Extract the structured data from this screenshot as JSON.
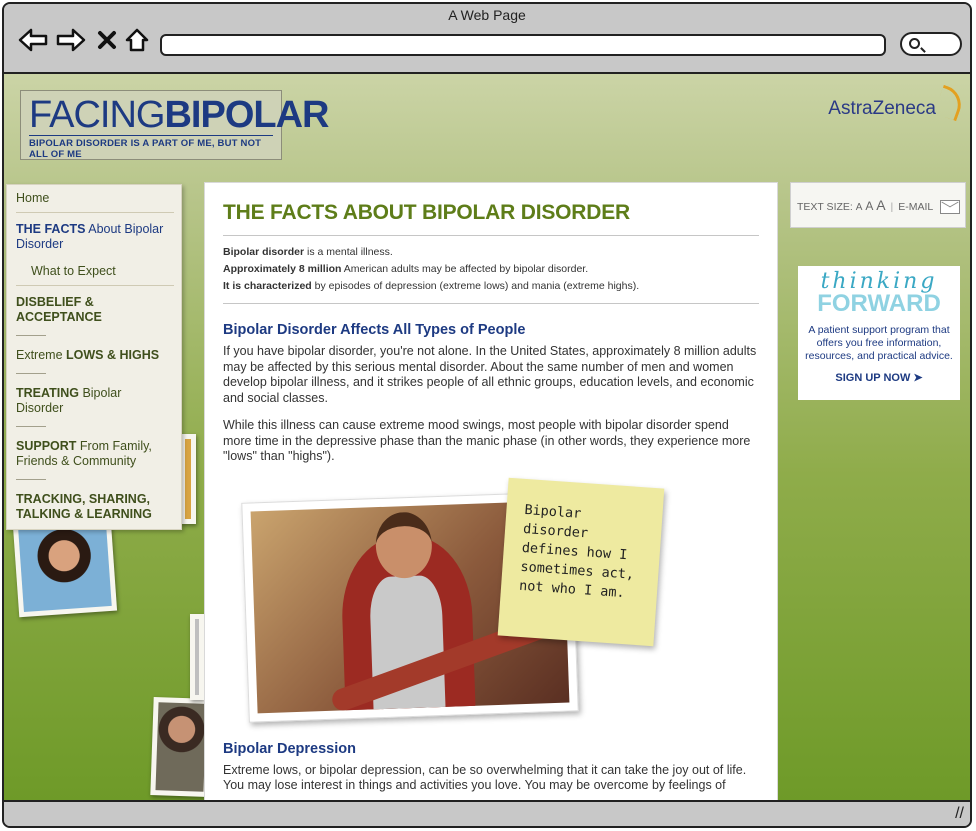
{
  "window": {
    "title": "A Web Page"
  },
  "browser": {
    "back_icon": "back-arrow-icon",
    "forward_icon": "forward-arrow-icon",
    "stop_icon": "close-icon",
    "home_icon": "home-icon",
    "search_icon": "search-icon"
  },
  "header": {
    "logo_thin": "FACING",
    "logo_bold": "BIPOLAR",
    "tagline": "BIPOLAR DISORDER IS A PART OF ME, BUT NOT ALL OF ME",
    "sponsor": "AstraZeneca"
  },
  "nav": {
    "home": "Home",
    "facts_bold": "THE FACTS",
    "facts_rest": " About Bipolar Disorder",
    "expect": "What to Expect",
    "disbelief": "DISBELIEF & ACCEPTANCE",
    "lows_pre": "Extreme ",
    "lows_bold": "LOWS & HIGHS",
    "treating_bold": "TREATING",
    "treating_rest": " Bipolar Disorder",
    "support_bold": "SUPPORT",
    "support_rest": " From Family, Friends & Community",
    "tracking": "TRACKING, SHARING, TALKING & LEARNING"
  },
  "content": {
    "title": "THE FACTS ABOUT BIPOLAR DISORDER",
    "facts": [
      {
        "bold": "Bipolar disorder",
        "rest": " is a mental illness."
      },
      {
        "bold": "Approximately 8 million",
        "rest": " American adults may be affected by bipolar disorder."
      },
      {
        "bold": "It is characterized",
        "rest": " by episodes of depression (extreme lows) and mania (extreme highs)."
      }
    ],
    "h2_types": "Bipolar Disorder Affects All Types of People",
    "p1": "If you have bipolar disorder, you're not alone. In the United States, approximately 8 million adults may be affected by this serious mental disorder. About the same number of men and women develop bipolar illness, and it strikes people of all ethnic groups, education levels, and economic and social classes.",
    "p2": "While this illness can cause extreme mood swings, most people with bipolar disorder spend more time in the depressive phase than the manic phase (in other words, they experience more \"lows\" than \"highs\").",
    "note": "Bipolar disorder defines how I sometimes act, not who I am.",
    "h2_depression": "Bipolar Depression",
    "p3": "Extreme lows, or bipolar depression, can be so overwhelming that it can take the joy out of life. You may lose interest in things and activities you love. You may be overcome by feelings of"
  },
  "tools": {
    "text_size_label": "TEXT SIZE:",
    "a_small": "A",
    "a_medium": "A",
    "a_large": "A",
    "email_label": "E-MAIL",
    "email_icon": "envelope-icon"
  },
  "promo": {
    "line1": "thinking",
    "line2": "FORWARD",
    "description": "A patient support program that offers you free information, resources, and practical advice.",
    "cta": "SIGN UP NOW ➤"
  },
  "colors": {
    "brand_green": "#5e7d19",
    "brand_blue": "#1d3a82",
    "background_green": "#8fac4a"
  }
}
